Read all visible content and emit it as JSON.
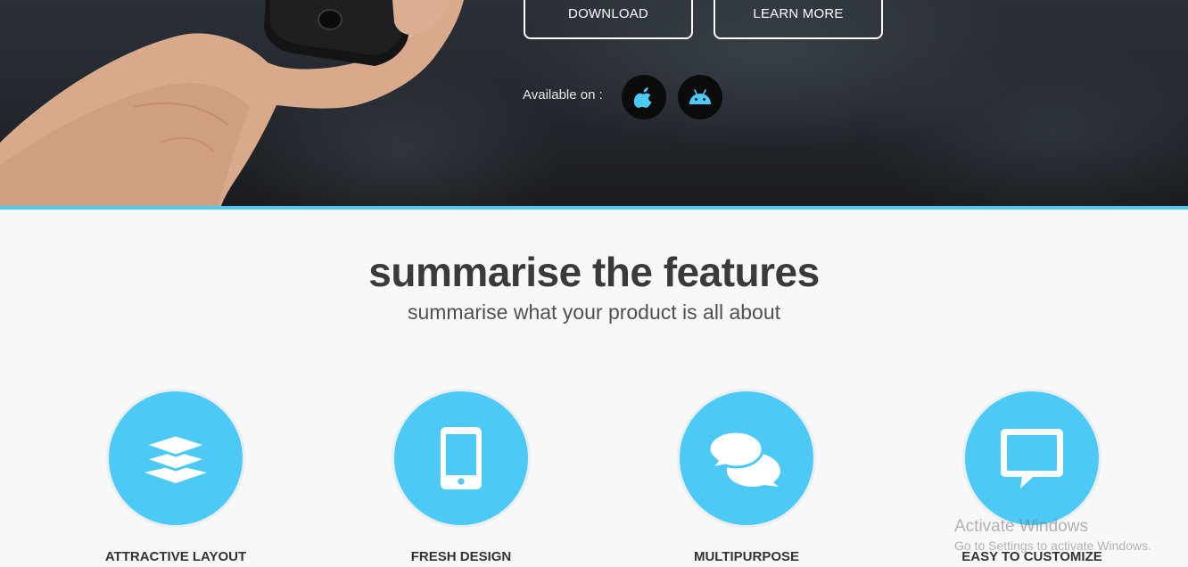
{
  "hero": {
    "buttons": {
      "download": "DOWNLOAD",
      "learn_more": "LEARN MORE"
    },
    "available_label": "Available on :",
    "stores": [
      {
        "icon": "apple-icon",
        "color": "#4dc9f6"
      },
      {
        "icon": "android-icon",
        "color": "#4dc9f6"
      }
    ],
    "accent_color": "#4dc9f6"
  },
  "features": {
    "title": "summarise the features",
    "subtitle": "summarise what your product is all about",
    "items": [
      {
        "icon": "layers-icon",
        "label": "ATTRACTIVE LAYOUT"
      },
      {
        "icon": "smartphone-icon",
        "label": "FRESH DESIGN"
      },
      {
        "icon": "chat-bubbles-icon",
        "label": "MULTIPURPOSE"
      },
      {
        "icon": "message-square-icon",
        "label": "EASY TO CUSTOMIZE"
      }
    ],
    "circle_color": "#4dc9f6"
  },
  "os_watermark": {
    "title": "Activate Windows",
    "subtitle": "Go to Settings to activate Windows."
  }
}
